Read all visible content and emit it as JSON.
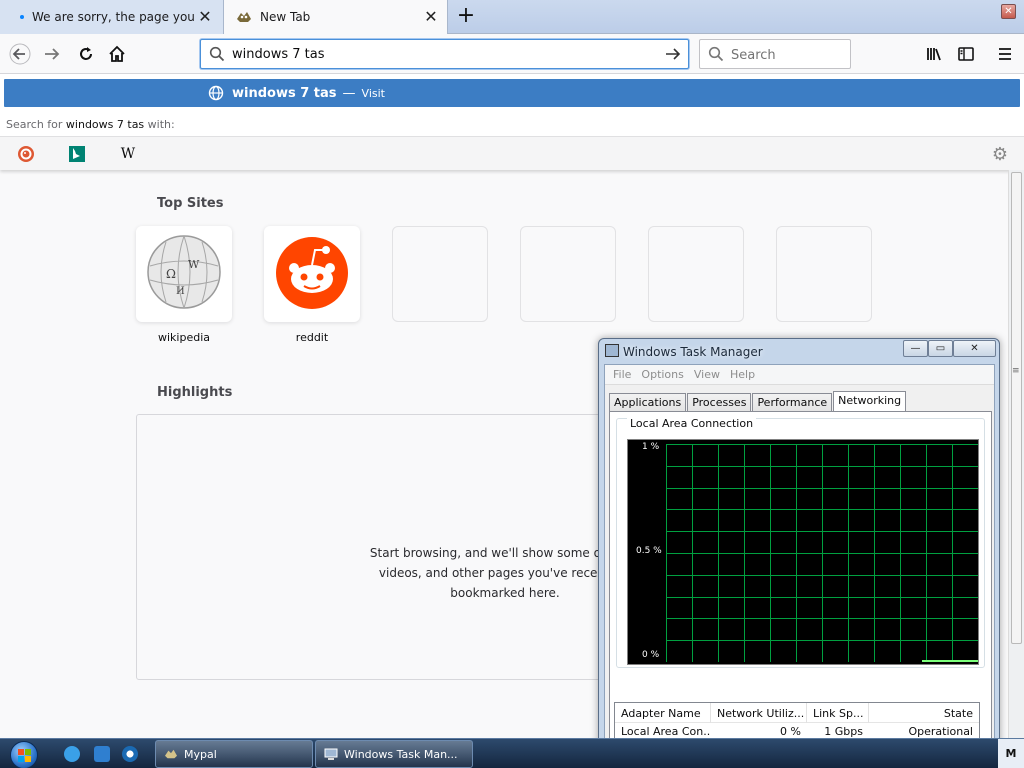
{
  "tabs": [
    {
      "title": "We are sorry, the page you requested",
      "active": false
    },
    {
      "title": "New Tab",
      "active": true
    }
  ],
  "toolbar": {
    "url_value": "windows 7 tas",
    "search_placeholder": "Search"
  },
  "autocomplete": {
    "suggestion_text": "windows 7 tas",
    "suggestion_separator": "—",
    "suggestion_action": "Visit",
    "search_with_prefix": "Search for",
    "search_with_query": "windows 7 tas",
    "search_with_suffix": "with:",
    "engines": [
      "duckduckgo-icon",
      "bing-icon",
      "wikipedia-icon"
    ],
    "wikipedia_glyph": "W"
  },
  "newtab": {
    "top_sites_title": "Top Sites",
    "top_sites": [
      {
        "label": "wikipedia",
        "icon": "wikipedia-icon"
      },
      {
        "label": "reddit",
        "icon": "reddit-icon"
      },
      {
        "label": ""
      },
      {
        "label": ""
      },
      {
        "label": ""
      },
      {
        "label": ""
      }
    ],
    "highlights_title": "Highlights",
    "highlights_empty_line1": "Start browsing, and we'll show some of the g",
    "highlights_empty_line2": "videos, and other pages you've recently v",
    "highlights_empty_line3": "bookmarked here."
  },
  "task_manager": {
    "title": "Windows Task Manager",
    "menu": [
      "File",
      "Options",
      "View",
      "Help"
    ],
    "tabs": [
      "Applications",
      "Processes",
      "Performance",
      "Networking"
    ],
    "active_tab": "Networking",
    "group_label": "Local Area Connection",
    "y_labels": [
      "1 %",
      "0.5 %",
      "0 %"
    ],
    "columns": [
      "Adapter Name",
      "Network Utiliz...",
      "Link Sp...",
      "State"
    ],
    "rows": [
      {
        "adapter": "Local Area Con...",
        "utilization": "0 %",
        "link_speed": "1 Gbps",
        "state": "Operational"
      }
    ]
  },
  "taskbar": {
    "buttons": [
      {
        "label": "Mypal"
      },
      {
        "label": "Windows Task Man..."
      }
    ],
    "tray_label": "M"
  },
  "colors": {
    "accent": "#3c7dc4",
    "reddit": "#ff4500",
    "graph_grid": "#00a040"
  }
}
